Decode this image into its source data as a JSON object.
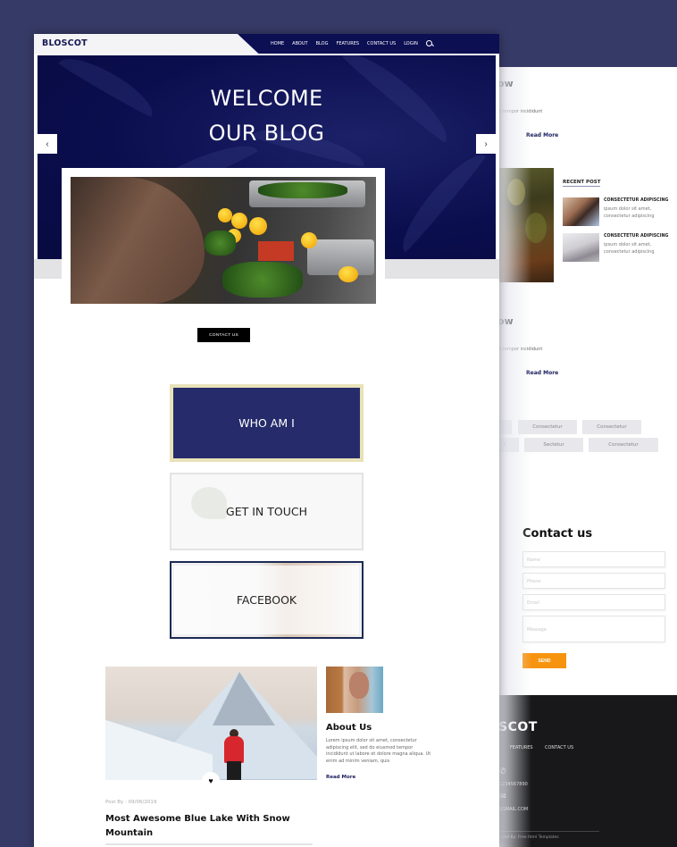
{
  "brand": {
    "name": "BLOSCOT",
    "accent": "#0c0f52",
    "send_color": "#f7940f"
  },
  "nav": {
    "items": [
      "HOME",
      "ABOUT",
      "BLOG",
      "FEATURES",
      "CONTACT US",
      "LOGIN"
    ],
    "search_icon": "search-icon"
  },
  "hero": {
    "title_line1": "WELCOME",
    "title_line2": "OUR BLOG",
    "prev_arrow": "‹",
    "next_arrow": "›"
  },
  "cta": {
    "contact_label": "CONTACT US"
  },
  "tiles": [
    "WHO AM I",
    "GET IN TOUCH",
    "FACEBOOK"
  ],
  "about": {
    "title": "About Us",
    "text": "Lorem ipsum dolor sit amet, consectetur adipiscing elit, sed do eiusmod tempor incididunt ut labore et dolore magna aliqua. Ut enim ad minim veniam, quis",
    "read_more": "Read More"
  },
  "post": {
    "meta": "Post By : 09/06/2019",
    "title": "Most Awesome Blue Lake With Snow Mountain",
    "heart_icon": "♥"
  },
  "sidebar": {
    "post_heading_fragment": "ow",
    "post_text_fragment": "od tempor incididunt",
    "read_more": "Read More",
    "recent_post_title": "RECENT POST",
    "recent_posts": [
      {
        "title": "CONSECTETUR ADIPISCING",
        "text": "ipsum dolor sit amet, consectetur adipiscing"
      },
      {
        "title": "CONSECTETUR ADIPISCING",
        "text": "ipsum dolor sit amet, consectetur adipiscing"
      }
    ],
    "tags_row1": [
      "",
      "Consectetur",
      "Consectetur"
    ],
    "tags_row2": [
      "r",
      "Sectetur",
      "Consectetur"
    ]
  },
  "contact_form": {
    "title": "Contact us",
    "name_placeholder": "Name",
    "phone_placeholder": "Phone",
    "email_placeholder": "Email",
    "message_placeholder": "Message",
    "send_label": "SEND"
  },
  "footer": {
    "logo_fragment": "SCOT",
    "nav": [
      "FEATURES",
      "CONTACT US"
    ],
    "phone_icon": "✆",
    "phone": "1234567890",
    "mail_icon": "✉",
    "email": "@GMAIL.COM",
    "copyright": "served By: Free html Templates"
  }
}
